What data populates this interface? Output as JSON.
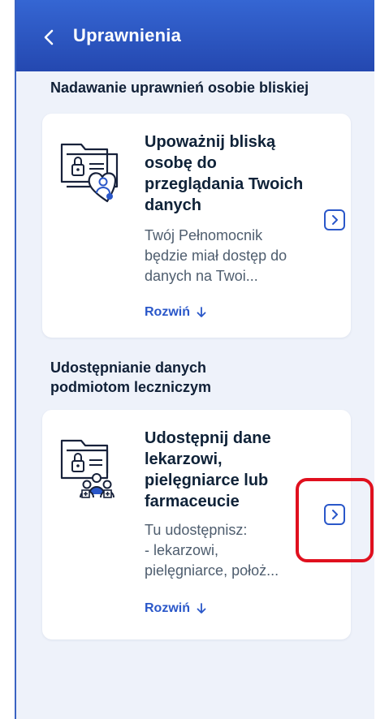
{
  "header": {
    "back_icon": "chevron-left-icon",
    "title": "Uprawnienia"
  },
  "sections": [
    {
      "title": "Nadawanie uprawnień osobie bliskiej",
      "card": {
        "icon": "folder-lock-heart-person-icon",
        "title": "Upoważnij bliską osobę do przeglądania Twoich danych",
        "description": "Twój Pełnomocnik będzie miał dostęp do danych na Twoi...",
        "expand_label": "Rozwiń",
        "expand_icon": "arrow-down-icon",
        "go_icon": "chevron-right-icon"
      }
    },
    {
      "title": "Udostępnianie danych podmiotom leczniczym",
      "card": {
        "icon": "folder-lock-medical-staff-icon",
        "title": "Udostępnij dane lekarzowi, pielęgniarce lub farmaceucie",
        "description": "Tu udostępnisz:\n - lekarzowi,\npielęgniarce, położ...",
        "expand_label": "Rozwiń",
        "expand_icon": "arrow-down-icon",
        "go_icon": "chevron-right-icon"
      }
    }
  ],
  "colors": {
    "header_gradient_top": "#3566d3",
    "header_gradient_bottom": "#2448b0",
    "background": "#eef2fa",
    "accent": "#2a57c9",
    "highlight": "#e0101e"
  }
}
